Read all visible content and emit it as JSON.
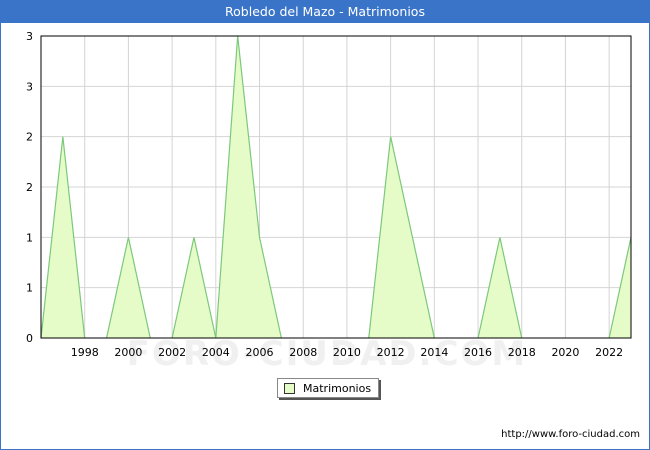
{
  "title": "Robledo del Mazo - Matrimonios",
  "source_url": "http://www.foro-ciudad.com",
  "watermark": "FORO-CIUDAD.COM",
  "colors": {
    "title_bar": "#3a74c9",
    "area_fill": "#e6fcc8",
    "area_line": "#7cc87c",
    "grid": "#d4d4d4"
  },
  "chart_data": {
    "type": "area",
    "title": "Robledo del Mazo - Matrimonios",
    "x": [
      1996,
      1997,
      1998,
      1999,
      2000,
      2001,
      2002,
      2003,
      2004,
      2005,
      2006,
      2007,
      2008,
      2009,
      2010,
      2011,
      2012,
      2013,
      2014,
      2015,
      2016,
      2017,
      2018,
      2019,
      2020,
      2021,
      2022,
      2023
    ],
    "series": [
      {
        "name": "Matrimonios",
        "values": [
          0,
          2,
          0,
          0,
          1,
          0,
          0,
          1,
          0,
          3,
          1,
          0,
          0,
          0,
          0,
          0,
          2,
          1,
          0,
          0,
          0,
          1,
          0,
          0,
          0,
          0,
          0,
          1
        ]
      }
    ],
    "x_ticks": [
      1998,
      2000,
      2002,
      2004,
      2006,
      2008,
      2010,
      2012,
      2014,
      2016,
      2018,
      2020,
      2022
    ],
    "y_tick_values": [
      0,
      0.5,
      1,
      1.5,
      2,
      2.5,
      3
    ],
    "y_tick_labels": [
      "0",
      "1",
      "1",
      "2",
      "2",
      "3",
      "3"
    ],
    "xlim": [
      1996,
      2023
    ],
    "ylim": [
      0,
      3
    ],
    "grid": true,
    "legend_position": "bottom-center"
  }
}
